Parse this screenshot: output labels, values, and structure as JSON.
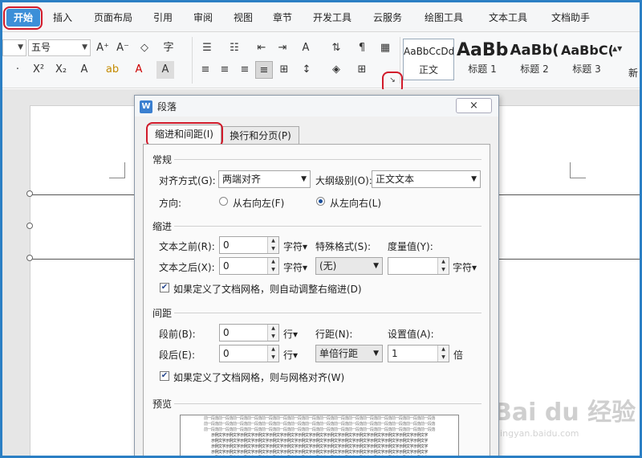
{
  "ribbon_tabs": [
    "开始",
    "插入",
    "页面布局",
    "引用",
    "审阅",
    "视图",
    "章节",
    "开发工具",
    "云服务",
    "绘图工具",
    "文本工具",
    "文档助手"
  ],
  "font_size": "五号",
  "styles": [
    {
      "sample": "AaBbCcDd",
      "caption": "正文"
    },
    {
      "sample": "AaBb",
      "caption": "标题 1"
    },
    {
      "sample": "AaBb(",
      "caption": "标题 2"
    },
    {
      "sample": "AaBbC(",
      "caption": "标题 3"
    },
    {
      "caption": "新"
    }
  ],
  "dialog": {
    "title": "段落",
    "close": "×",
    "tabs": [
      "缩进和间距(I)",
      "换行和分页(P)"
    ],
    "general": {
      "section": "常规",
      "align_label": "对齐方式(G):",
      "align_value": "两端对齐",
      "outline_label": "大纲级别(O):",
      "outline_value": "正文文本",
      "direction_label": "方向:",
      "rtl": "从右向左(F)",
      "ltr": "从左向右(L)"
    },
    "indent": {
      "section": "缩进",
      "before_label": "文本之前(R):",
      "before_value": "0",
      "before_unit": "字符▾",
      "special_label": "特殊格式(S):",
      "measure_label": "度量值(Y):",
      "after_label": "文本之后(X):",
      "after_value": "0",
      "after_unit": "字符▾",
      "special_value": "(无)",
      "measure_value": "",
      "measure_unit": "字符▾",
      "auto_adjust": "如果定义了文档网格，则自动调整右缩进(D)"
    },
    "spacing": {
      "section": "间距",
      "before_label": "段前(B):",
      "before_value": "0",
      "before_unit": "行▾",
      "line_label": "行距(N):",
      "setting_label": "设置值(A):",
      "after_label": "段后(E):",
      "after_value": "0",
      "after_unit": "行▾",
      "line_value": "单倍行距",
      "setting_value": "1",
      "setting_unit": "倍",
      "snap_grid": "如果定义了文档网格，则与网格对齐(W)"
    },
    "preview": {
      "section": "预览",
      "line_gray": "前一段落前一段落前一段落前一段落前一段落前一段落前一段落前一段落前一段落前一段落前一段落前一段落前一段落前一段落前一段落前一段落",
      "line_dark": "示例文字示例文字示例文字示例文字示例文字示例文字示例文字示例文字示例文字示例文字示例文字示例文字示例文字示例文字示例文字"
    }
  },
  "watermark": {
    "brand": "Bai du 经验",
    "url": "jingyan.baidu.com"
  }
}
